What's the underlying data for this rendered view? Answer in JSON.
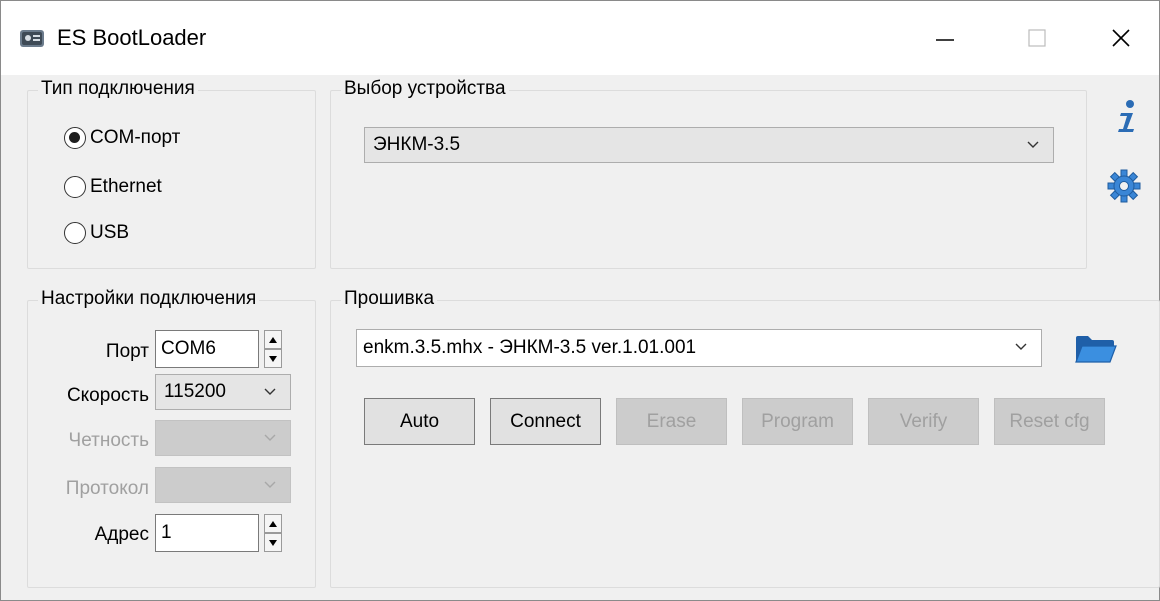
{
  "window": {
    "title": "ES BootLoader"
  },
  "connection_type": {
    "title": "Тип подключения",
    "options": [
      {
        "label": "COM-порт",
        "checked": true
      },
      {
        "label": "Ethernet",
        "checked": false
      },
      {
        "label": "USB",
        "checked": false
      }
    ]
  },
  "device": {
    "title": "Выбор устройства",
    "selected": "ЭНКМ-3.5"
  },
  "settings": {
    "title": "Настройки подключения",
    "port_label": "Порт",
    "port_value": "COM6",
    "speed_label": "Скорость",
    "speed_value": "115200",
    "parity_label": "Четность",
    "parity_value": "",
    "protocol_label": "Протокол",
    "protocol_value": "",
    "address_label": "Адрес",
    "address_value": "1"
  },
  "firmware": {
    "title": "Прошивка",
    "selected": "enkm.3.5.mhx  - ЭНКМ-3.5 ver.1.01.001",
    "buttons": {
      "auto": "Auto",
      "connect": "Connect",
      "erase": "Erase",
      "program": "Program",
      "verify": "Verify",
      "reset_cfg": "Reset cfg"
    }
  },
  "icons": {
    "info": "info-icon",
    "settings": "gear-icon",
    "open_folder": "folder-icon"
  },
  "colors": {
    "accent_icon": "#2f7fd0",
    "disabled_text": "#a0a0a0"
  }
}
